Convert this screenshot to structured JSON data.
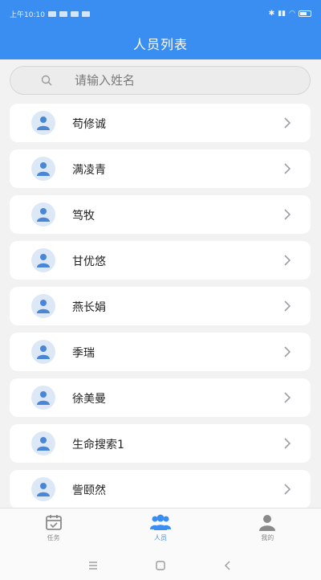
{
  "status_bar": {
    "time": "上午10:10"
  },
  "header": {
    "title": "人员列表"
  },
  "search": {
    "placeholder": "请输入姓名"
  },
  "people": [
    {
      "name": "苟修诚"
    },
    {
      "name": "满凌青"
    },
    {
      "name": "笃牧"
    },
    {
      "name": "甘优悠"
    },
    {
      "name": "燕长娟"
    },
    {
      "name": "季瑞"
    },
    {
      "name": "徐美曼"
    },
    {
      "name": "生命搜索1"
    },
    {
      "name": "訾颐然"
    }
  ],
  "tabbar": {
    "tabs": [
      {
        "label": "任务",
        "icon": "calendar-task-icon",
        "active": false
      },
      {
        "label": "人员",
        "icon": "people-group-icon",
        "active": true
      },
      {
        "label": "我的",
        "icon": "person-icon",
        "active": false
      }
    ]
  },
  "colors": {
    "brand": "#3a8ef2",
    "background": "#f2f2f2",
    "avatar_bg": "#dde8f7",
    "avatar_fg": "#4a86d6"
  }
}
